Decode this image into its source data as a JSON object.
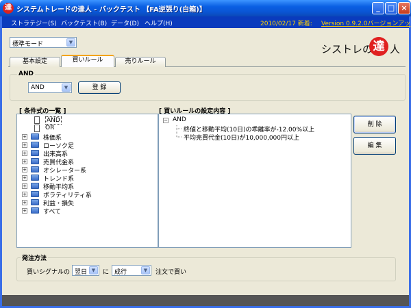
{
  "window": {
    "title": "システムトレードの達人 - バックテスト 【FA逆張り(白箱)】"
  },
  "icons": {
    "app": "達",
    "minimize": "_",
    "maximize": "□",
    "close": "×",
    "dropdown": "▼",
    "seal": "達"
  },
  "menu": {
    "items": [
      "ストラテジー(S)",
      "バックテスト(B)",
      "データ(D)",
      "ヘルプ(H)"
    ],
    "date_label": "2010/02/17 新着:",
    "version_link": "Version 0.9.2.0バージョンアッ"
  },
  "mode_select": {
    "value": "標準モード"
  },
  "logo": {
    "part1": "シストレの",
    "part2": "人"
  },
  "tabs": [
    "基本設定",
    "買いルール",
    "売りルール"
  ],
  "and_group": {
    "label": "AND",
    "select_value": "AND",
    "register_button": "登 録"
  },
  "condition_list": {
    "label": "[ 条件式の一覧 ]",
    "items": [
      {
        "label": "AND",
        "type": "doc"
      },
      {
        "label": "OR",
        "type": "doc"
      },
      {
        "label": "株価系",
        "type": "folder"
      },
      {
        "label": "ローソク足",
        "type": "folder"
      },
      {
        "label": "出来高系",
        "type": "folder"
      },
      {
        "label": "売買代金系",
        "type": "folder"
      },
      {
        "label": "オシレーター系",
        "type": "folder"
      },
      {
        "label": "トレンド系",
        "type": "folder"
      },
      {
        "label": "移動平均系",
        "type": "folder"
      },
      {
        "label": "ボラティリティ系",
        "type": "folder"
      },
      {
        "label": "利益・損失",
        "type": "folder"
      },
      {
        "label": "すべて",
        "type": "folder"
      }
    ]
  },
  "rule_settings": {
    "label": "[ 買いルールの設定内容 ]",
    "root": "AND",
    "children": [
      "終値と移動平均(10日)の乖離率が-12.00%以上",
      "平均売買代金(10日)が10,000,000円以上"
    ]
  },
  "buttons": {
    "delete": "削 除",
    "edit": "編 集"
  },
  "order": {
    "label": "発注方法",
    "prefix": "買いシグナルの",
    "timing": "翌日",
    "mid": "に",
    "type": "成行",
    "suffix": "注文で買い"
  }
}
